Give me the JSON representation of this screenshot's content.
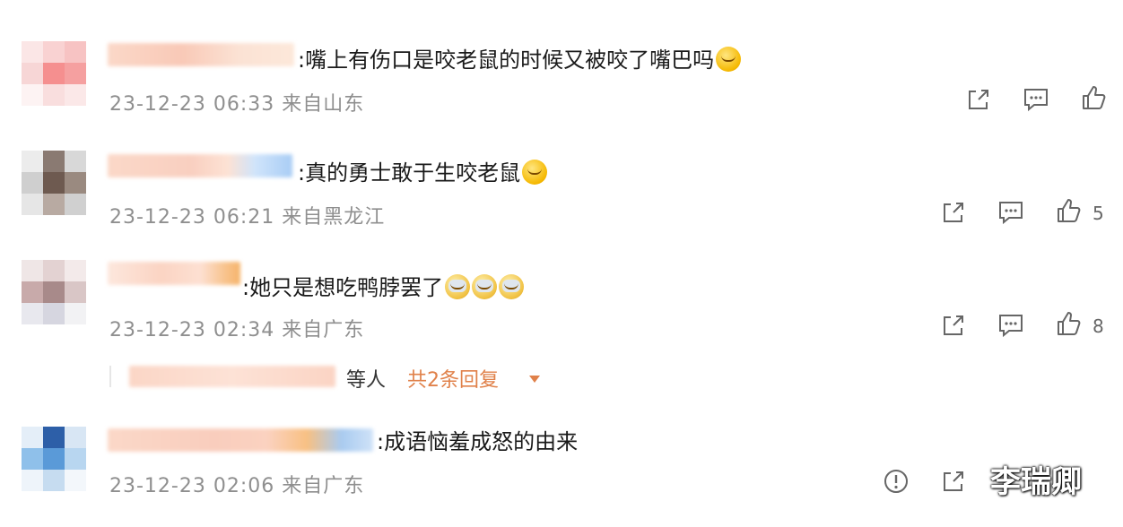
{
  "comments": [
    {
      "text": ":嘴上有伤口是咬老鼠的时候又被咬了嘴巴吗",
      "emoji": "sad-face",
      "meta": "23-12-23 06:33 来自山东",
      "likes": ""
    },
    {
      "text": ":真的勇士敢于生咬老鼠",
      "emoji": "crying-face",
      "meta": "23-12-23 06:21 来自黑龙江",
      "likes": "5"
    },
    {
      "text": ":她只是想吃鸭脖罢了",
      "emoji": "shocked-face",
      "meta": "23-12-23 02:34 来自广东",
      "likes": "8",
      "reply_names_suffix": "等人",
      "reply_link": "共2条回复"
    },
    {
      "text": ":成语恼羞成怒的由来",
      "meta": "23-12-23 02:06 来自广东"
    }
  ],
  "watermark": "李瑞卿",
  "colors": {
    "accent": "#e0814a",
    "meta": "#8f8f8f",
    "icon": "#666666"
  }
}
